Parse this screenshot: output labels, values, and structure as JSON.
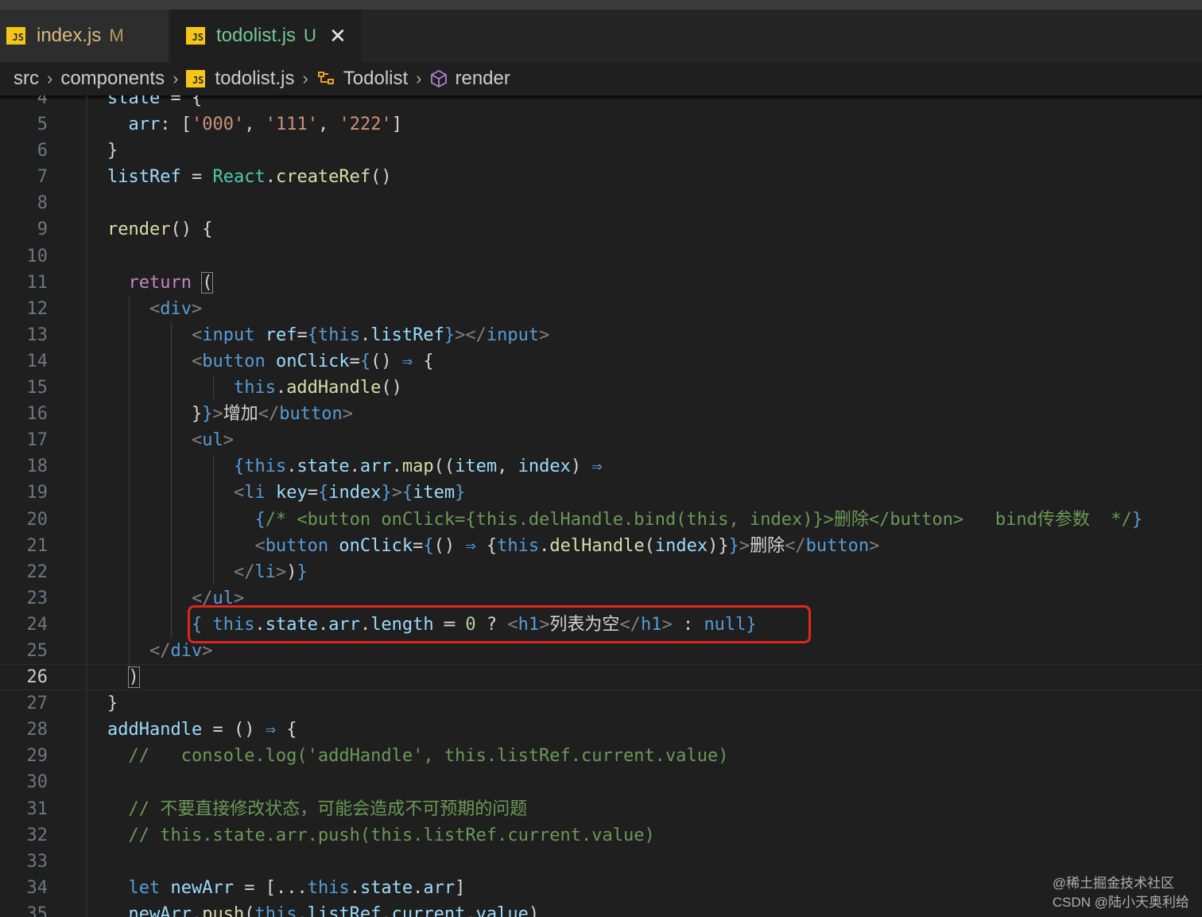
{
  "tabs": [
    {
      "label": "index.js",
      "badge": "M",
      "icon": "js-file-icon"
    },
    {
      "label": "todolist.js",
      "badge": "U",
      "icon": "js-file-icon",
      "close_icon": "close-icon"
    }
  ],
  "breadcrumb": {
    "items": [
      "src",
      "components",
      "todolist.js",
      "Todolist",
      "render"
    ],
    "icons": [
      "js-file-icon",
      "class-icon",
      "method-cube-icon"
    ]
  },
  "colors": {
    "keyword": "#569cd6",
    "control": "#c586c0",
    "function": "#dcdcaa",
    "variable": "#9cdcfe",
    "string": "#ce9178",
    "type": "#4ec9b0",
    "comment": "#6a9955",
    "highlight_box": "#e0261e"
  },
  "editor": {
    "current_line": 26,
    "lines": [
      {
        "n": "4",
        "text": "state = {"
      },
      {
        "n": "5",
        "text": "  arr: ['000', '111', '222']"
      },
      {
        "n": "6",
        "text": "}"
      },
      {
        "n": "7",
        "text": "listRef = React.createRef()"
      },
      {
        "n": "8",
        "text": ""
      },
      {
        "n": "9",
        "text": "render() {"
      },
      {
        "n": "10",
        "text": ""
      },
      {
        "n": "11",
        "text": "  return ("
      },
      {
        "n": "12",
        "text": "    <div>"
      },
      {
        "n": "13",
        "text": "        <input ref={this.listRef}></input>"
      },
      {
        "n": "14",
        "text": "        <button onClick={() ⇒ {"
      },
      {
        "n": "15",
        "text": "            this.addHandle()"
      },
      {
        "n": "16",
        "text": "        }}>增加</button>"
      },
      {
        "n": "17",
        "text": "        <ul>"
      },
      {
        "n": "18",
        "text": "            {this.state.arr.map((item, index) ⇒"
      },
      {
        "n": "19",
        "text": "            <li key={index}>{item}"
      },
      {
        "n": "20",
        "text": "              {/* <button onClick={this.delHandle.bind(this, index)}>删除</button>   bind传参数  */}"
      },
      {
        "n": "21",
        "text": "              <button onClick={() ⇒ {this.delHandle(index)}}>删除</button>"
      },
      {
        "n": "22",
        "text": "            </li>)}"
      },
      {
        "n": "23",
        "text": "        </ul>"
      },
      {
        "n": "24",
        "text": "        { this.state.arr.length ═ 0 ? <h1>列表为空</h1> : null}"
      },
      {
        "n": "25",
        "text": "    </div>"
      },
      {
        "n": "26",
        "text": "  )"
      },
      {
        "n": "27",
        "text": "}"
      },
      {
        "n": "28",
        "text": "addHandle = () ⇒ {"
      },
      {
        "n": "29",
        "text": "  //   console.log('addHandle', this.listRef.current.value)"
      },
      {
        "n": "30",
        "text": ""
      },
      {
        "n": "31",
        "text": "  // 不要直接修改状态，可能会造成不可预期的问题"
      },
      {
        "n": "32",
        "text": "  // this.state.arr.push(this.listRef.current.value)"
      },
      {
        "n": "33",
        "text": ""
      },
      {
        "n": "34",
        "text": "  let newArr = [...this.state.arr]"
      },
      {
        "n": "35",
        "text": "  newArr.push(this.listRef.current.value)"
      }
    ]
  },
  "watermark": {
    "line1": "@稀土掘金技术社区",
    "line2": "CSDN @陆小天奥利给"
  }
}
